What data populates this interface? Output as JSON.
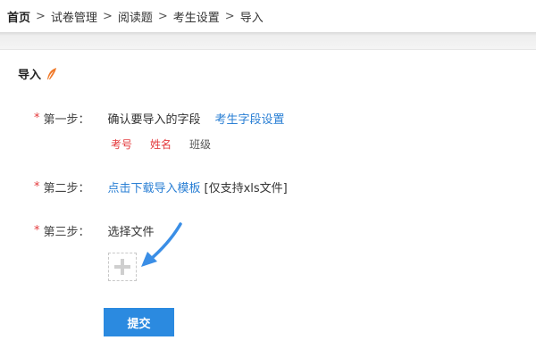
{
  "breadcrumb": {
    "home": "首页",
    "separator": ">",
    "items": [
      "试卷管理",
      "阅读题",
      "考生设置",
      "导入"
    ]
  },
  "section": {
    "title": "导入",
    "icon": "feather-icon"
  },
  "steps": [
    {
      "required_mark": "*",
      "label": "第一步：",
      "text": "确认要导入的字段",
      "link": "考生字段设置"
    },
    {
      "required_mark": "*",
      "label": "第二步：",
      "link": "点击下载导入模板",
      "note": "[仅支持xls文件]"
    },
    {
      "required_mark": "*",
      "label": "第三步：",
      "text": "选择文件"
    }
  ],
  "fields": {
    "required": [
      "考号",
      "姓名"
    ],
    "optional": [
      "班级"
    ]
  },
  "upload": {
    "icon": "plus-icon"
  },
  "submit_label": "提交",
  "colors": {
    "accent": "#2b8ae0",
    "link": "#2a7fd4",
    "required": "#e4393c",
    "feather": "#f07a2a"
  }
}
